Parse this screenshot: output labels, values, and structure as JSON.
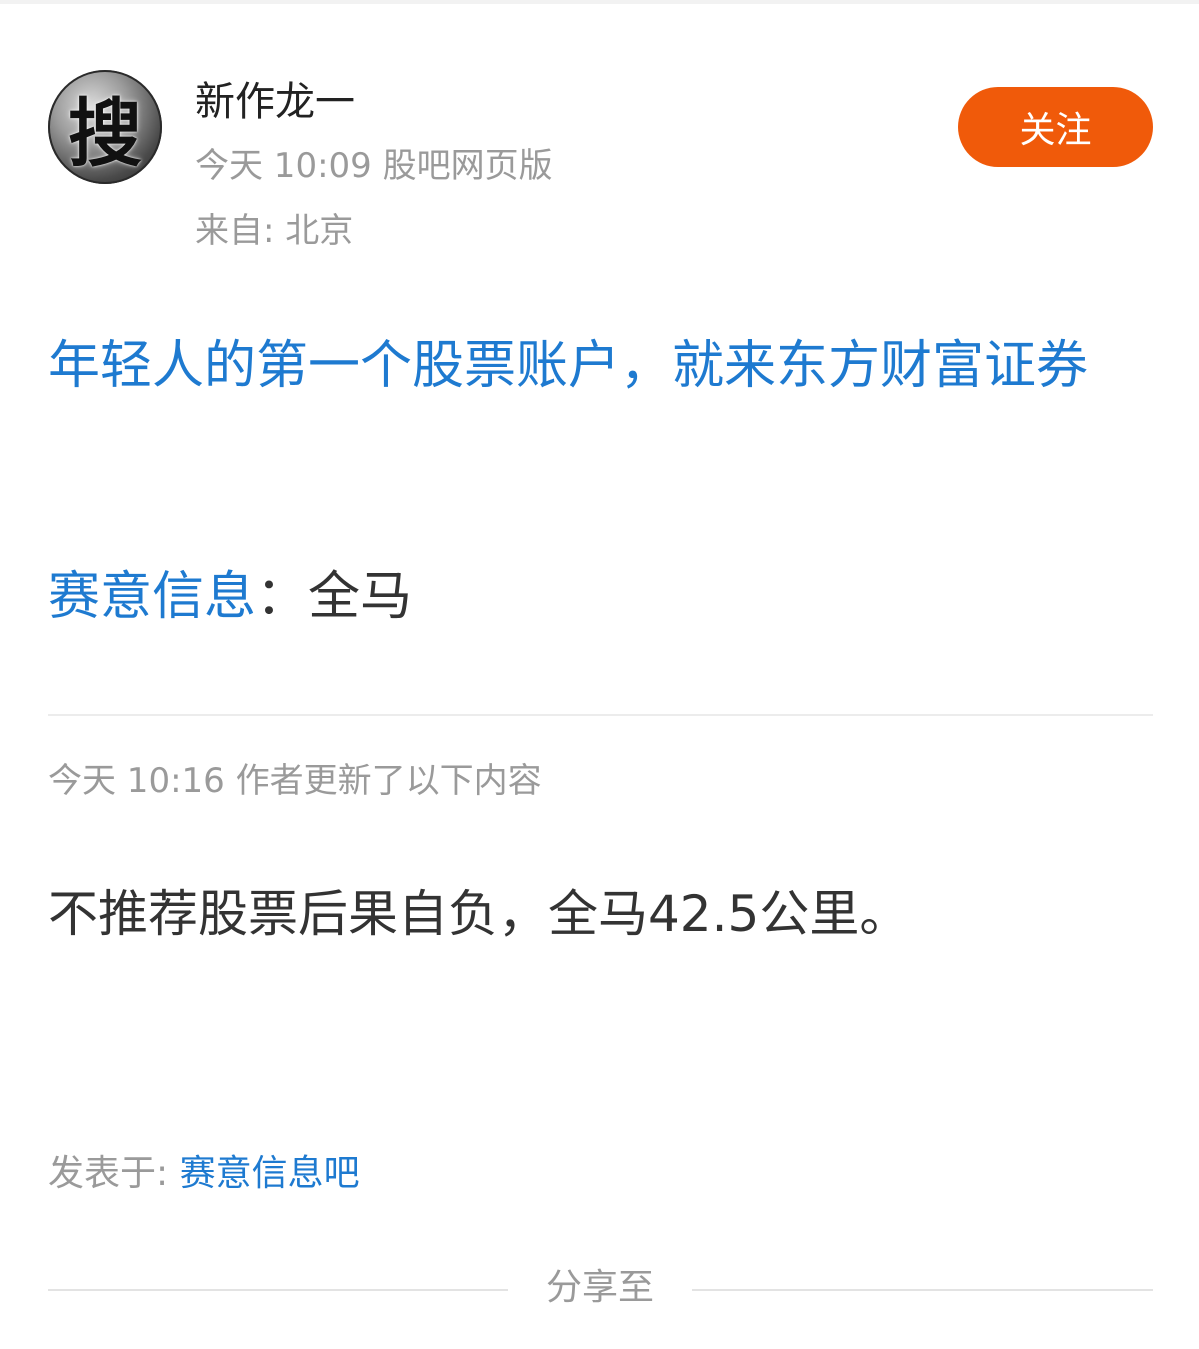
{
  "post": {
    "author": {
      "name": "新作龙一",
      "avatar_glyph": "搜",
      "meta": "今天 10:09 股吧网页版",
      "location": "来自: 北京"
    },
    "follow_label": "关注",
    "promo_link": "年轻人的第一个股票账户，就来东方财富证券",
    "topic": {
      "name": "赛意信息",
      "separator": "：",
      "text": "全马"
    },
    "update": {
      "meta": "今天 10:16  作者更新了以下内容",
      "text": "不推荐股票后果自负，全马42.5公里。"
    },
    "posted_in": {
      "label": "发表于: ",
      "forum": "赛意信息吧"
    },
    "share_label": "分享至"
  },
  "colors": {
    "accent_blue": "#1e7ad0",
    "follow_orange": "#f05a0a",
    "meta_gray": "#9a9a9a"
  }
}
